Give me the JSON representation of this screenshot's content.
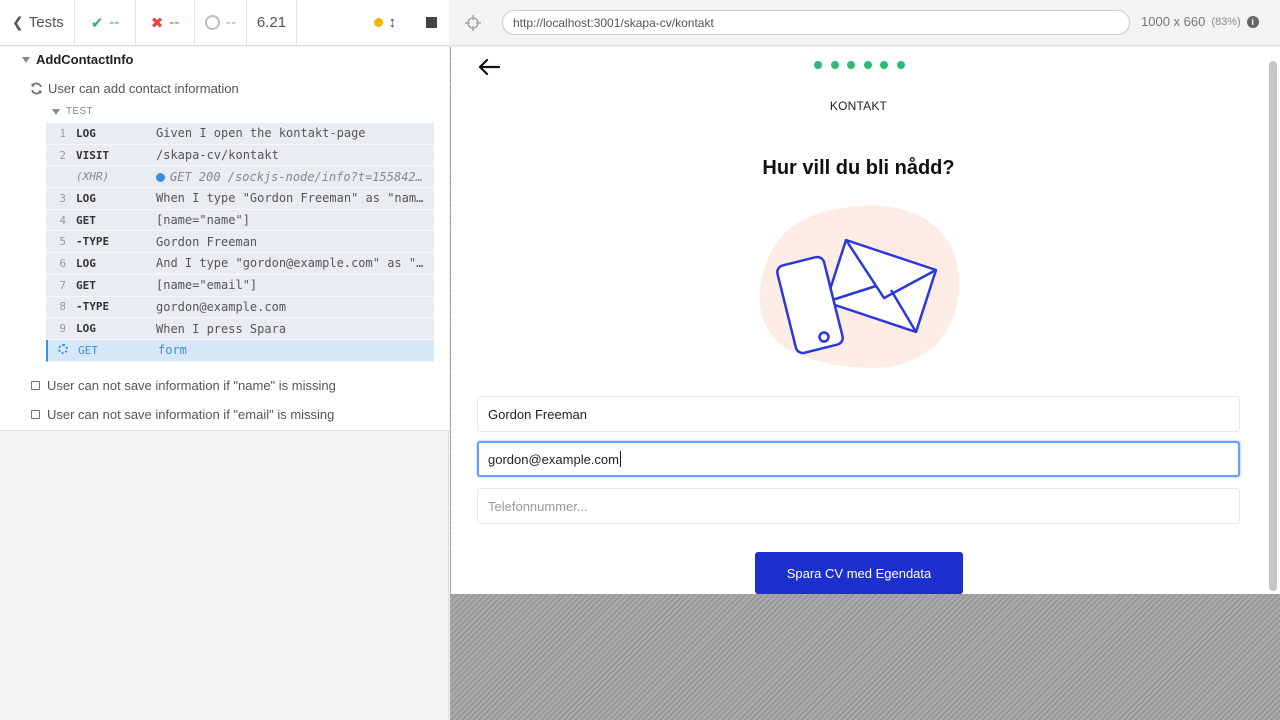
{
  "reporter": {
    "header": {
      "tests_label": "Tests",
      "passed": "--",
      "failed": "--",
      "pending": "--",
      "duration": "6.21"
    },
    "suite_title": "AddContactInfo",
    "test_title": "User can add contact information",
    "test_section_label": "TEST",
    "commands": [
      {
        "num": "1",
        "name": "LOG",
        "message": "Given I open the kontakt-page"
      },
      {
        "num": "2",
        "name": "VISIT",
        "message": "/skapa-cv/kontakt"
      },
      {
        "num": "",
        "name": "(XHR)",
        "message": "GET 200 /sockjs-node/info?t=1558428..."
      },
      {
        "num": "3",
        "name": "LOG",
        "message": "When I type \"Gordon Freeman\" as \"nam..."
      },
      {
        "num": "4",
        "name": "GET",
        "message": "[name=\"name\"]"
      },
      {
        "num": "5",
        "name": "-TYPE",
        "message": "Gordon Freeman"
      },
      {
        "num": "6",
        "name": "LOG",
        "message": "And I type \"gordon@example.com\" as \"..."
      },
      {
        "num": "7",
        "name": "GET",
        "message": "[name=\"email\"]"
      },
      {
        "num": "8",
        "name": "-TYPE",
        "message": "gordon@example.com"
      },
      {
        "num": "9",
        "name": "LOG",
        "message": "When I press Spara"
      },
      {
        "num": "",
        "name": "GET",
        "message": "form"
      }
    ],
    "pending_tests": [
      "User can not save information if \"name\" is missing",
      "User can not save information if \"email\" is missing"
    ]
  },
  "aut": {
    "url": "http://localhost:3001/skapa-cv/kontakt",
    "viewport": "1000 x 660",
    "scale": "(83%)",
    "page": {
      "label": "KONTAKT",
      "heading": "Hur vill du bli nådd?",
      "fields": {
        "name_value": "Gordon Freeman",
        "email_value": "gordon@example.com",
        "phone_placeholder": "Telefonnummer..."
      },
      "save_button": "Spara CV med Egendata",
      "steps_total": 6
    }
  },
  "colors": {
    "accent_green": "#2db87a",
    "button_blue": "#1d2fcf",
    "pass": "#2fb36e",
    "fail": "#e0443a",
    "running_blue": "#3a8ee6"
  }
}
